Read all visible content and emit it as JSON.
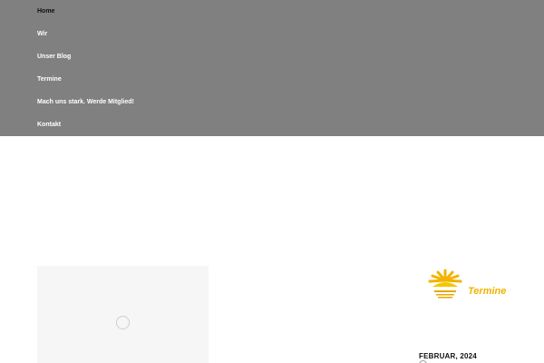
{
  "nav": {
    "items": [
      {
        "label": "Home"
      },
      {
        "label": "Wir"
      },
      {
        "label": "Unser Blog"
      },
      {
        "label": "Termine"
      },
      {
        "label": "Mach uns stark. Werde Mitglied!"
      },
      {
        "label": "Kontakt"
      }
    ],
    "active_index": 0
  },
  "sidebar": {
    "logo_word": "Termine",
    "month_heading": "FEBRUAR, 2024"
  },
  "colors": {
    "nav_overlay": "#808080",
    "accent_yellow": "#f2b300"
  }
}
